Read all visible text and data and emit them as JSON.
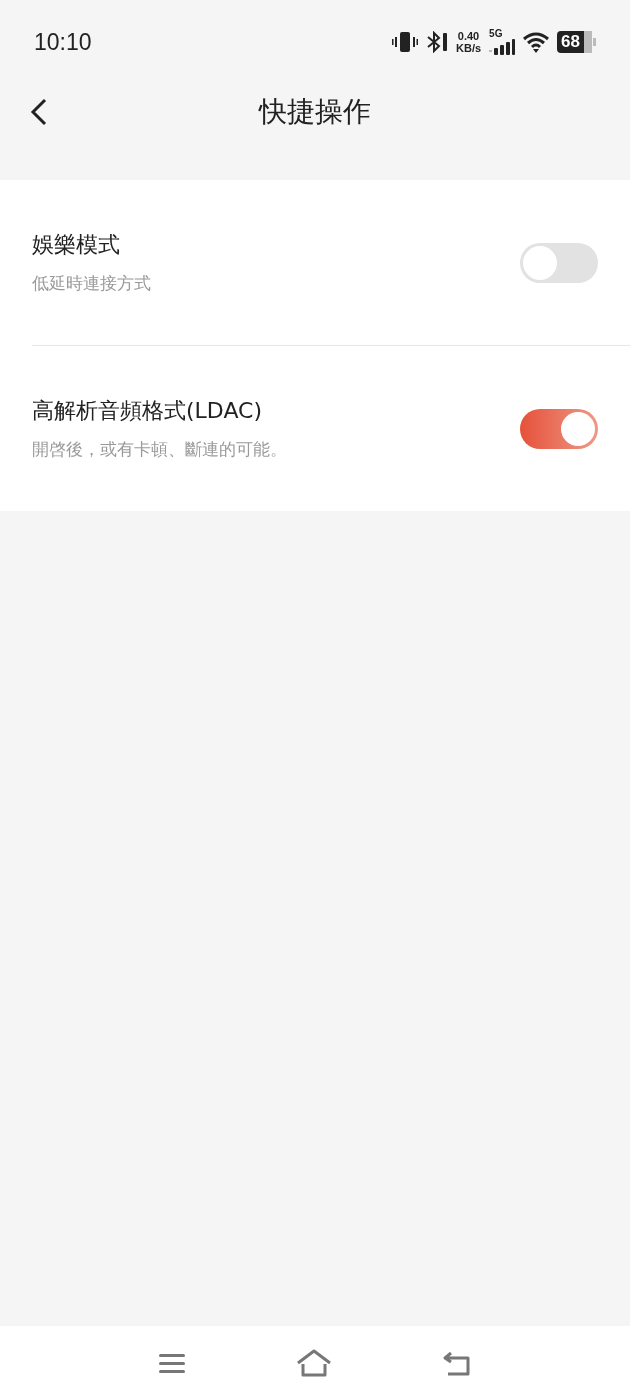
{
  "status_bar": {
    "time": "10:10",
    "speed_value": "0.40",
    "speed_unit": "KB/s",
    "network": "5G",
    "battery": "68"
  },
  "header": {
    "title": "快捷操作"
  },
  "settings": [
    {
      "title": "娛樂模式",
      "subtitle": "低延時連接方式",
      "on": false
    },
    {
      "title": "高解析音頻格式(LDAC)",
      "subtitle": "開啓後，或有卡頓、斷連的可能。",
      "on": true
    }
  ]
}
